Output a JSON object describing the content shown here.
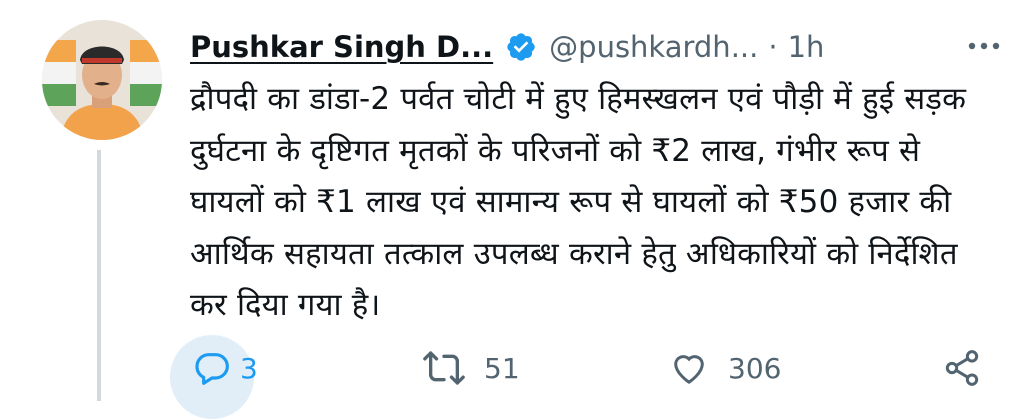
{
  "author": {
    "display_name": "Pushkar Singh D...",
    "handle": "@pushkardh...",
    "separator": "·",
    "timestamp": "1h"
  },
  "tweet": {
    "text": "द्रौपदी का डांडा-2 पर्वत चोटी में हुए हिमस्खलन एवं पौड़ी में हुई सड़क दुर्घटना के दृष्टिगत मृतकों के परिजनों को ₹2 लाख, गंभीर रूप से घायलों को ₹1 लाख एवं सामान्य रूप से घायलों को ₹50 हजार की आर्थिक सहायता तत्काल उपलब्ध कराने हेतु अधिकारियों को निर्देशित कर दिया गया है।"
  },
  "actions": {
    "replies": "3",
    "retweets": "51",
    "likes": "306"
  },
  "icons": {
    "verified": "verified-badge-icon",
    "more": "more-horizontal-icon",
    "reply": "reply-icon",
    "retweet": "retweet-icon",
    "like": "heart-icon",
    "share": "share-icon"
  },
  "colors": {
    "verified_blue": "#1d9bf0",
    "reply_active": "#1d9bf0",
    "muted": "#536471",
    "text": "#0f1419"
  }
}
